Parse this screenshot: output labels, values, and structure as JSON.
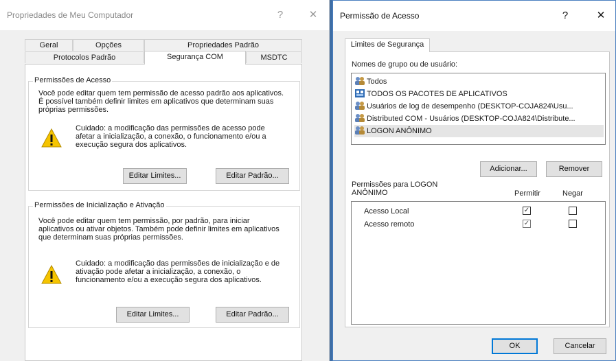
{
  "left_dialog": {
    "title": "Propriedades de Meu Computador",
    "help_glyph": "?",
    "close_glyph": "✕",
    "tabs_row1": [
      "Geral",
      "Opções",
      "Propriedades Padrão"
    ],
    "tabs_row2": [
      "Protocolos Padrão",
      "Segurança COM",
      "MSDTC"
    ],
    "access_group": {
      "title": "Permissões de Acesso",
      "description": "Você pode editar quem tem permissão de acesso padrão aos aplicativos. É possível também definir limites em aplicativos que determinam suas próprias permissões.",
      "warning": "Cuidado: a modificação das permissões de acesso pode afetar a inicialização, a conexão, o funcionamento e/ou a execução segura dos aplicativos.",
      "edit_limits_label": "Editar Limites...",
      "edit_default_label": "Editar Padrão..."
    },
    "launch_group": {
      "title": "Permissões de Inicialização e Ativação",
      "description": "Você pode editar quem tem permissão, por padrão, para iniciar aplicativos ou ativar objetos. Também pode definir limites em aplicativos que determinam suas próprias permissões.",
      "warning": "Cuidado: a modificação das permissões de inicialização e de ativação pode afetar a inicialização, a conexão, o funcionamento e/ou a execução segura dos aplicativos.",
      "edit_limits_label": "Editar Limites...",
      "edit_default_label": "Editar Padrão..."
    }
  },
  "right_dialog": {
    "title": "Permissão de Acesso",
    "help_glyph": "?",
    "close_glyph": "✕",
    "tab": "Limites de Segurança",
    "users_label": "Nomes de grupo ou de usuário:",
    "users": [
      {
        "name": "Todos",
        "icon": "users-icon"
      },
      {
        "name": "TODOS OS PACOTES DE APLICATIVOS",
        "icon": "app-packages-icon"
      },
      {
        "name": "Usuários de log de desempenho (DESKTOP-COJA824\\Usu...",
        "icon": "users-icon"
      },
      {
        "name": "Distributed COM - Usuários (DESKTOP-COJA824\\Distribute...",
        "icon": "users-icon"
      },
      {
        "name": "LOGON ANÔNIMO",
        "icon": "users-icon"
      }
    ],
    "add_label": "Adicionar...",
    "remove_label": "Remover",
    "permissions_label_line1": "Permissões para LOGON",
    "permissions_label_line2": "ANÔNIMO",
    "allow_header": "Permitir",
    "deny_header": "Negar",
    "permissions": [
      {
        "name": "Acesso Local",
        "allow": true,
        "deny": false
      },
      {
        "name": "Acesso remoto",
        "allow": true,
        "deny": false
      }
    ],
    "check_glyph": "✓",
    "ok_label": "OK",
    "cancel_label": "Cancelar"
  },
  "colors": {
    "desktop": "#3f6ea5",
    "dialog_bg": "#f0f0f0",
    "focus_blue": "#0078d7",
    "warning_yellow": "#f5c400"
  }
}
